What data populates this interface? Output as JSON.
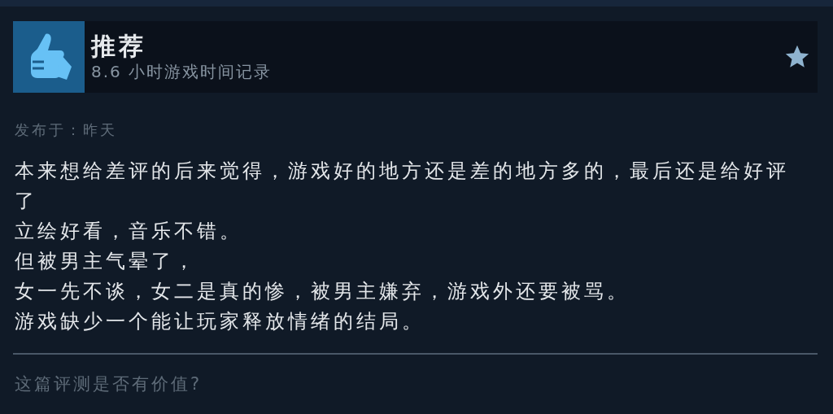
{
  "review": {
    "verdict": "推荐",
    "hours": "8.6 小时游戏时间记录",
    "awarded": true,
    "posted": "发布于：昨天",
    "lines": [
      "本来想给差评的后来觉得，游戏好的地方还是差的地方多的，最后还是给好评了",
      "立绘好看，音乐不错。",
      "但被男主气晕了，",
      "女一先不谈，女二是真的惨，被男主嫌弃，游戏外还要被骂。",
      "游戏缺少一个能让玩家释放情绪的结局。"
    ],
    "helpful_prompt": "这篇评测是否有价值?"
  }
}
